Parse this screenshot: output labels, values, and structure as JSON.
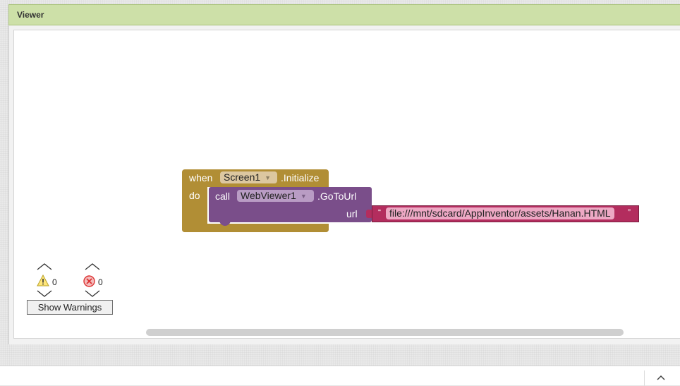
{
  "viewer": {
    "title": "Viewer"
  },
  "blocks": {
    "event": {
      "when_label": "when",
      "component": "Screen1",
      "event_name": ".Initialize",
      "do_label": "do"
    },
    "call": {
      "call_label": "call",
      "component": "WebViewer1",
      "method": ".GoToUrl",
      "arg_label": "url"
    },
    "text": {
      "open_quote": "“",
      "value": "file:///mnt/sdcard/AppInventor/assets/Hanan.HTML",
      "close_quote": "”"
    }
  },
  "warnings": {
    "warning_count": "0",
    "error_count": "0",
    "show_button_label": "Show Warnings"
  },
  "colors": {
    "event_block": "#b18e35",
    "call_block": "#7a4e8a",
    "text_block": "#b32d5e",
    "viewer_header": "#cde0a8"
  },
  "icons": [
    "warning-icon",
    "error-icon",
    "chevron-up-icon",
    "chevron-down-icon"
  ]
}
